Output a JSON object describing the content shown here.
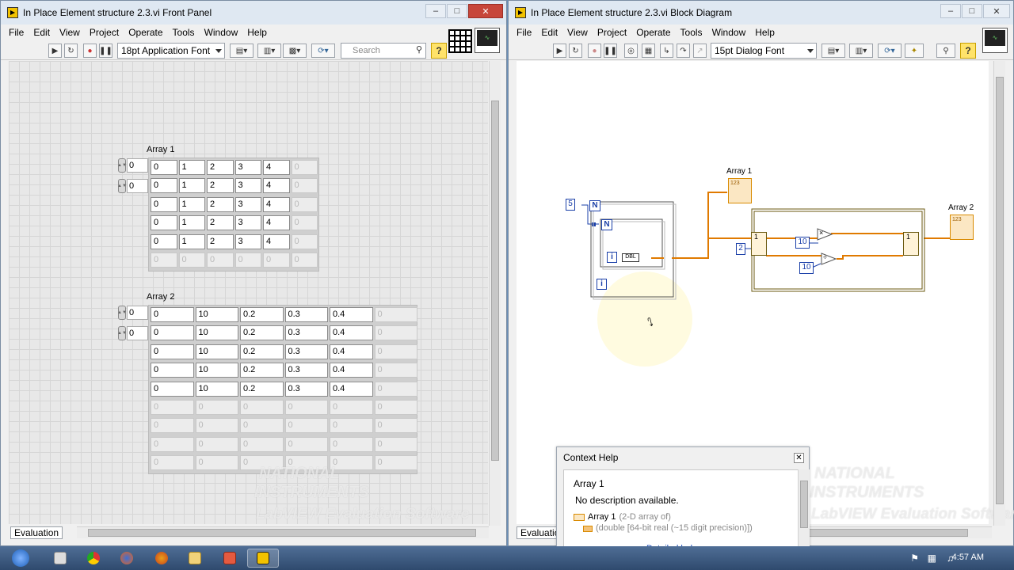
{
  "front_panel": {
    "title": "In Place Element structure 2.3.vi Front Panel",
    "menu": [
      "File",
      "Edit",
      "View",
      "Project",
      "Operate",
      "Tools",
      "Window",
      "Help"
    ],
    "font": "18pt Application Font",
    "search_placeholder": "Search",
    "array1": {
      "label": "Array 1",
      "index": [
        "0",
        "0"
      ],
      "rows": [
        [
          "0",
          "1",
          "2",
          "3",
          "4",
          "0"
        ],
        [
          "0",
          "1",
          "2",
          "3",
          "4",
          "0"
        ],
        [
          "0",
          "1",
          "2",
          "3",
          "4",
          "0"
        ],
        [
          "0",
          "1",
          "2",
          "3",
          "4",
          "0"
        ],
        [
          "0",
          "1",
          "2",
          "3",
          "4",
          "0"
        ],
        [
          "0",
          "0",
          "0",
          "0",
          "0",
          "0"
        ]
      ]
    },
    "array2": {
      "label": "Array 2",
      "index": [
        "0",
        "0"
      ],
      "rows": [
        [
          "0",
          "10",
          "0.2",
          "0.3",
          "0.4",
          "0"
        ],
        [
          "0",
          "10",
          "0.2",
          "0.3",
          "0.4",
          "0"
        ],
        [
          "0",
          "10",
          "0.2",
          "0.3",
          "0.4",
          "0"
        ],
        [
          "0",
          "10",
          "0.2",
          "0.3",
          "0.4",
          "0"
        ],
        [
          "0",
          "10",
          "0.2",
          "0.3",
          "0.4",
          "0"
        ],
        [
          "0",
          "0",
          "0",
          "0",
          "0",
          "0"
        ],
        [
          "0",
          "0",
          "0",
          "0",
          "0",
          "0"
        ],
        [
          "0",
          "0",
          "0",
          "0",
          "0",
          "0"
        ],
        [
          "0",
          "0",
          "0",
          "0",
          "0",
          "0"
        ]
      ]
    },
    "status": "Evaluation",
    "watermark": [
      "NATIONAL",
      "INSTRUMENTS",
      "LabVIEW Evaluation Software"
    ]
  },
  "block_diagram": {
    "title": "In Place Element structure 2.3.vi Block Diagram",
    "menu": [
      "File",
      "Edit",
      "View",
      "Project",
      "Operate",
      "Tools",
      "Window",
      "Help"
    ],
    "font": "15pt Dialog Font",
    "status": "Evaluation",
    "array1_label": "Array 1",
    "array2_label": "Array 2",
    "const_5": "5",
    "const_2": "2",
    "const_10a": "10",
    "const_10b": "10",
    "N": "N",
    "i": "i",
    "one": "1",
    "dbl": "DBL",
    "ind": "123",
    "multiply": "×",
    "divide": "÷",
    "watermark": [
      "NATIONAL",
      "INSTRUMENTS",
      "LabVIEW Evaluation Software"
    ]
  },
  "context_help": {
    "title": "Context Help",
    "name": "Array 1",
    "desc": "No description available.",
    "type_line1": "Array 1",
    "type_line1_suffix": "(2-D array of)",
    "type_line2": "(double [64-bit real (~15 digit precision)])",
    "detailed": "Detailed help"
  },
  "taskbar": {
    "clock": "4:57 AM"
  }
}
